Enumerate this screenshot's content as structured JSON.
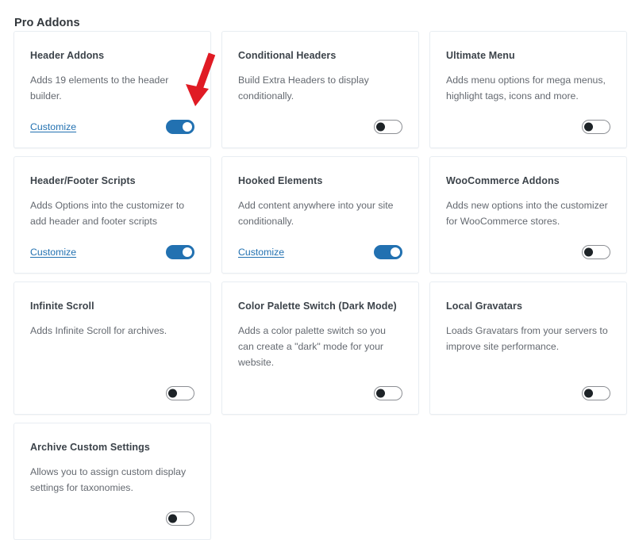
{
  "page": {
    "title": "Pro Addons",
    "background_color": "#ffffff"
  },
  "theme": {
    "accent_on_color": "#2271b1",
    "link_color": "#2271b1",
    "toggle_off_knob_color": "#1d2327",
    "toggle_off_border_color": "#8c8f94",
    "card_border_color": "#e8edf2",
    "title_color": "#3c434a",
    "description_color": "#646970",
    "annotation_color": "#e01b24"
  },
  "labels": {
    "customize": "Customize"
  },
  "annotation": {
    "type": "arrow",
    "points_to": "header-addons-toggle",
    "color": "#e01b24"
  },
  "addons": [
    {
      "title": "Header Addons",
      "description": "Adds 19 elements to the header builder.",
      "has_customize_link": true,
      "customize_label": "Customize",
      "enabled": true,
      "toggle_state": "on"
    },
    {
      "title": "Conditional Headers",
      "description": "Build Extra Headers to display conditionally.",
      "has_customize_link": false,
      "customize_label": "",
      "enabled": false,
      "toggle_state": "off"
    },
    {
      "title": "Ultimate Menu",
      "description": "Adds menu options for mega menus, highlight tags, icons and more.",
      "has_customize_link": false,
      "customize_label": "",
      "enabled": false,
      "toggle_state": "off"
    },
    {
      "title": "Header/Footer Scripts",
      "description": "Adds Options into the customizer to add header and footer scripts",
      "has_customize_link": true,
      "customize_label": "Customize",
      "enabled": true,
      "toggle_state": "on"
    },
    {
      "title": "Hooked Elements",
      "description": "Add content anywhere into your site conditionally.",
      "has_customize_link": true,
      "customize_label": "Customize",
      "enabled": true,
      "toggle_state": "on"
    },
    {
      "title": "WooCommerce Addons",
      "description": "Adds new options into the customizer for WooCommerce stores.",
      "has_customize_link": false,
      "customize_label": "",
      "enabled": false,
      "toggle_state": "off"
    },
    {
      "title": "Infinite Scroll",
      "description": "Adds Infinite Scroll for archives.",
      "has_customize_link": false,
      "customize_label": "",
      "enabled": false,
      "toggle_state": "off"
    },
    {
      "title": "Color Palette Switch (Dark Mode)",
      "description": "Adds a color palette switch so you can create a \"dark\" mode for your website.",
      "has_customize_link": false,
      "customize_label": "",
      "enabled": false,
      "toggle_state": "off"
    },
    {
      "title": "Local Gravatars",
      "description": "Loads Gravatars from your servers to improve site performance.",
      "has_customize_link": false,
      "customize_label": "",
      "enabled": false,
      "toggle_state": "off"
    },
    {
      "title": "Archive Custom Settings",
      "description": "Allows you to assign custom display settings for taxonomies.",
      "has_customize_link": false,
      "customize_label": "",
      "enabled": false,
      "toggle_state": "off"
    }
  ]
}
